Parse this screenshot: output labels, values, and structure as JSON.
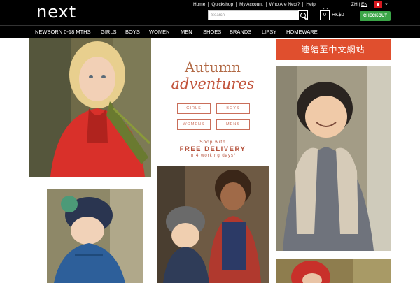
{
  "brand": {
    "logo": "next"
  },
  "utility_links": [
    "Home",
    "Quickshop",
    "My Account",
    "Who Are Next?",
    "Help"
  ],
  "language": {
    "zh": "ZH",
    "separator": "|",
    "en": "EN"
  },
  "search": {
    "placeholder": "Search"
  },
  "bag": {
    "count": "0",
    "total": "HK$0"
  },
  "checkout_label": "CHECKOUT",
  "nav": [
    "NEWBORN 0-18 MTHS",
    "GIRLS",
    "BOYS",
    "WOMEN",
    "MEN",
    "SHOES",
    "BRANDS",
    "LIPSY",
    "HOMEWARE"
  ],
  "promo": {
    "title": "Autumn",
    "script": "adventures",
    "buttons": [
      "GIRLS",
      "BOYS",
      "WOMENS",
      "MENS"
    ],
    "shop_with": "Shop with",
    "free_delivery": "FREE DELIVERY",
    "working_days": "in 4 working days*"
  },
  "cn_link": "連結至中文網站",
  "colors": {
    "checkout": "#3aa547",
    "cn_banner": "#e04f2e",
    "promo_text": "#b5523c"
  }
}
